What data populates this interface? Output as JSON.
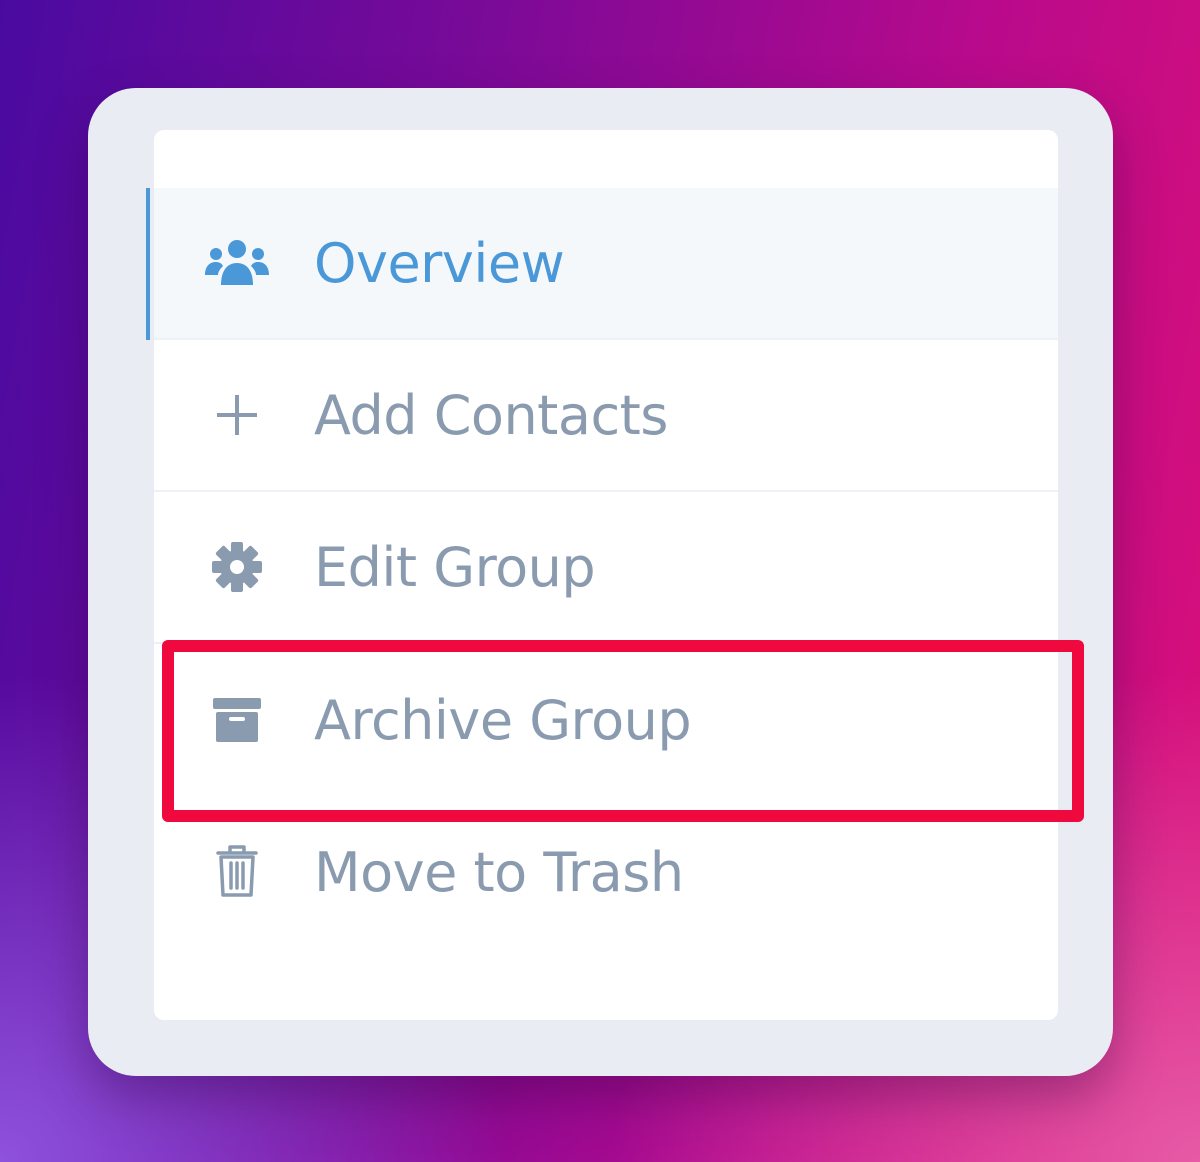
{
  "menu": {
    "items": [
      {
        "label": "Overview",
        "icon": "users-icon",
        "active": true
      },
      {
        "label": "Add Contacts",
        "icon": "plus-icon",
        "active": false
      },
      {
        "label": "Edit Group",
        "icon": "gear-icon",
        "active": false
      },
      {
        "label": "Archive Group",
        "icon": "archive-icon",
        "active": false,
        "highlighted": true
      },
      {
        "label": "Move to Trash",
        "icon": "trash-icon",
        "active": false
      }
    ]
  },
  "colors": {
    "active": "#4a98d8",
    "inactive": "#8a9bb0",
    "highlight_border": "#f0093e",
    "card_bg": "#e9edf3",
    "menu_bg": "#ffffff"
  }
}
